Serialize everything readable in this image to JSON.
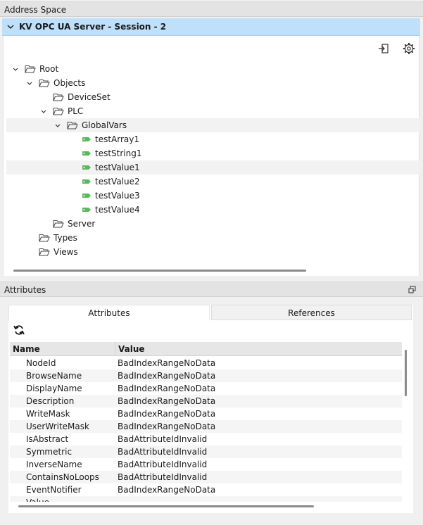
{
  "address_panel": {
    "title": "Address Space"
  },
  "session": {
    "label": "KV OPC UA Server - Session - 2"
  },
  "toolbar": {
    "connect_icon": "login-icon",
    "settings_icon": "gear-icon"
  },
  "tree": [
    {
      "label": "Root",
      "level": 0,
      "expanded": true,
      "type": "folder"
    },
    {
      "label": "Objects",
      "level": 1,
      "expanded": true,
      "type": "folder"
    },
    {
      "label": "DeviceSet",
      "level": 2,
      "expanded": null,
      "type": "folder"
    },
    {
      "label": "PLC",
      "level": 2,
      "expanded": true,
      "type": "folder"
    },
    {
      "label": "GlobalVars",
      "level": 3,
      "expanded": true,
      "type": "folder",
      "selected": true
    },
    {
      "label": "testArray1",
      "level": 4,
      "type": "tag"
    },
    {
      "label": "testString1",
      "level": 4,
      "type": "tag"
    },
    {
      "label": "testValue1",
      "level": 4,
      "type": "tag",
      "selected": true
    },
    {
      "label": "testValue2",
      "level": 4,
      "type": "tag"
    },
    {
      "label": "testValue3",
      "level": 4,
      "type": "tag"
    },
    {
      "label": "testValue4",
      "level": 4,
      "type": "tag"
    },
    {
      "label": "Server",
      "level": 2,
      "expanded": null,
      "type": "folder"
    },
    {
      "label": "Types",
      "level": 1,
      "expanded": null,
      "type": "folder"
    },
    {
      "label": "Views",
      "level": 1,
      "expanded": null,
      "type": "folder"
    }
  ],
  "attributes_panel": {
    "title": "Attributes",
    "restore_icon": "restore-window-icon"
  },
  "tabs": [
    {
      "label": "Attributes",
      "active": true
    },
    {
      "label": "References",
      "active": false
    }
  ],
  "refresh_icon": "refresh-icon",
  "grid": {
    "headers": [
      "Name",
      "Value"
    ],
    "rows": [
      [
        "NodeId",
        "BadIndexRangeNoData"
      ],
      [
        "BrowseName",
        "BadIndexRangeNoData"
      ],
      [
        "DisplayName",
        "BadIndexRangeNoData"
      ],
      [
        "Description",
        "BadIndexRangeNoData"
      ],
      [
        "WriteMask",
        "BadIndexRangeNoData"
      ],
      [
        "UserWriteMask",
        "BadIndexRangeNoData"
      ],
      [
        "IsAbstract",
        "BadAttributeIdInvalid"
      ],
      [
        "Symmetric",
        "BadAttributeIdInvalid"
      ],
      [
        "InverseName",
        "BadAttributeIdInvalid"
      ],
      [
        "ContainsNoLoops",
        "BadAttributeIdInvalid"
      ],
      [
        "EventNotifier",
        "BadIndexRangeNoData"
      ],
      [
        "Value",
        ""
      ]
    ]
  },
  "colors": {
    "session_bg": "#bfe0fb",
    "tag_green": "#5cb85c",
    "header_bg": "#e3e3e3"
  }
}
